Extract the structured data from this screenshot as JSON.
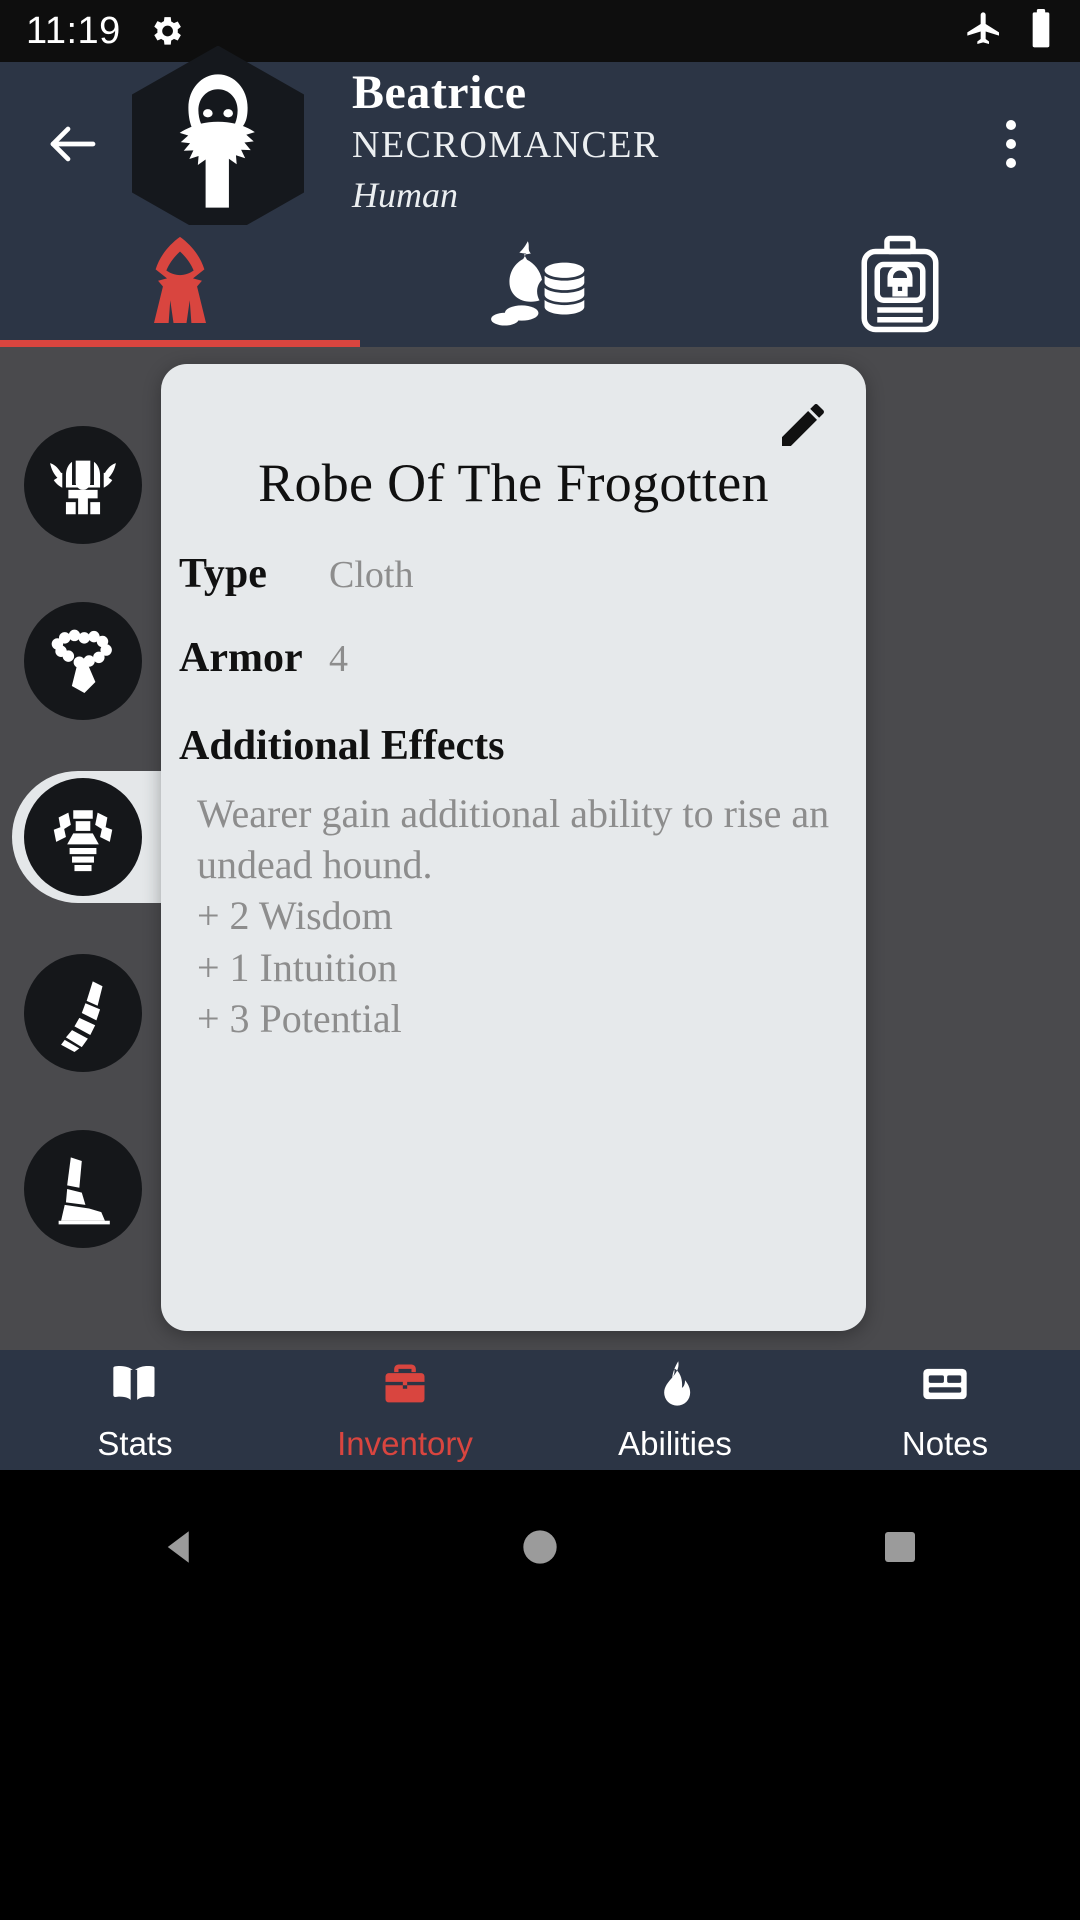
{
  "status_bar": {
    "time": "11:19",
    "icons": [
      "gear-icon",
      "airplane-mode-icon",
      "battery-icon"
    ]
  },
  "header": {
    "back_icon": "back-arrow-icon",
    "avatar_icon": "hooded-figure-avatar-icon",
    "character_name": "Beatrice",
    "character_class": "NECROMANCER",
    "character_race": "Human",
    "overflow_icon": "more-vertical-icon"
  },
  "top_tabs": [
    {
      "id": "equipment",
      "icon": "robe-icon",
      "active": true
    },
    {
      "id": "currency",
      "icon": "money-bag-coins-icon",
      "active": false
    },
    {
      "id": "backpack",
      "icon": "backpack-icon",
      "active": false
    }
  ],
  "equipment_slots": [
    {
      "id": "head",
      "icon": "horned-helmet-icon",
      "selected": false
    },
    {
      "id": "neck",
      "icon": "necklace-amulet-icon",
      "selected": false
    },
    {
      "id": "chest",
      "icon": "chest-armor-icon",
      "selected": true
    },
    {
      "id": "hands",
      "icon": "gauntlet-icon",
      "selected": false
    },
    {
      "id": "feet",
      "icon": "boot-icon",
      "selected": false
    }
  ],
  "item_card": {
    "edit_icon": "pencil-edit-icon",
    "title": "Robe Of The Frogotten",
    "type_label": "Type",
    "type_value": "Cloth",
    "armor_label": "Armor",
    "armor_value": "4",
    "effects_heading": "Additional Effects",
    "effects_description": "Wearer gain additional ability to rise an undead hound.",
    "bonuses": [
      "+ 2 Wisdom",
      "+ 1 Intuition",
      "+ 3 Potential"
    ]
  },
  "bottom_nav": [
    {
      "id": "stats",
      "label": "Stats",
      "icon": "book-icon",
      "active": false
    },
    {
      "id": "inventory",
      "label": "Inventory",
      "icon": "briefcase-icon",
      "active": true
    },
    {
      "id": "abilities",
      "label": "Abilities",
      "icon": "flame-icon",
      "active": false
    },
    {
      "id": "notes",
      "label": "Notes",
      "icon": "note-card-icon",
      "active": false
    }
  ],
  "system_nav": {
    "back_icon": "system-back-triangle-icon",
    "home_icon": "system-home-circle-icon",
    "recents_icon": "system-recents-square-icon"
  },
  "colors": {
    "header_bg": "#2c3545",
    "accent_red": "#d9453f",
    "content_bg": "#4a4a4d",
    "card_bg": "#e6e9eb",
    "slot_bg": "#15171a"
  }
}
